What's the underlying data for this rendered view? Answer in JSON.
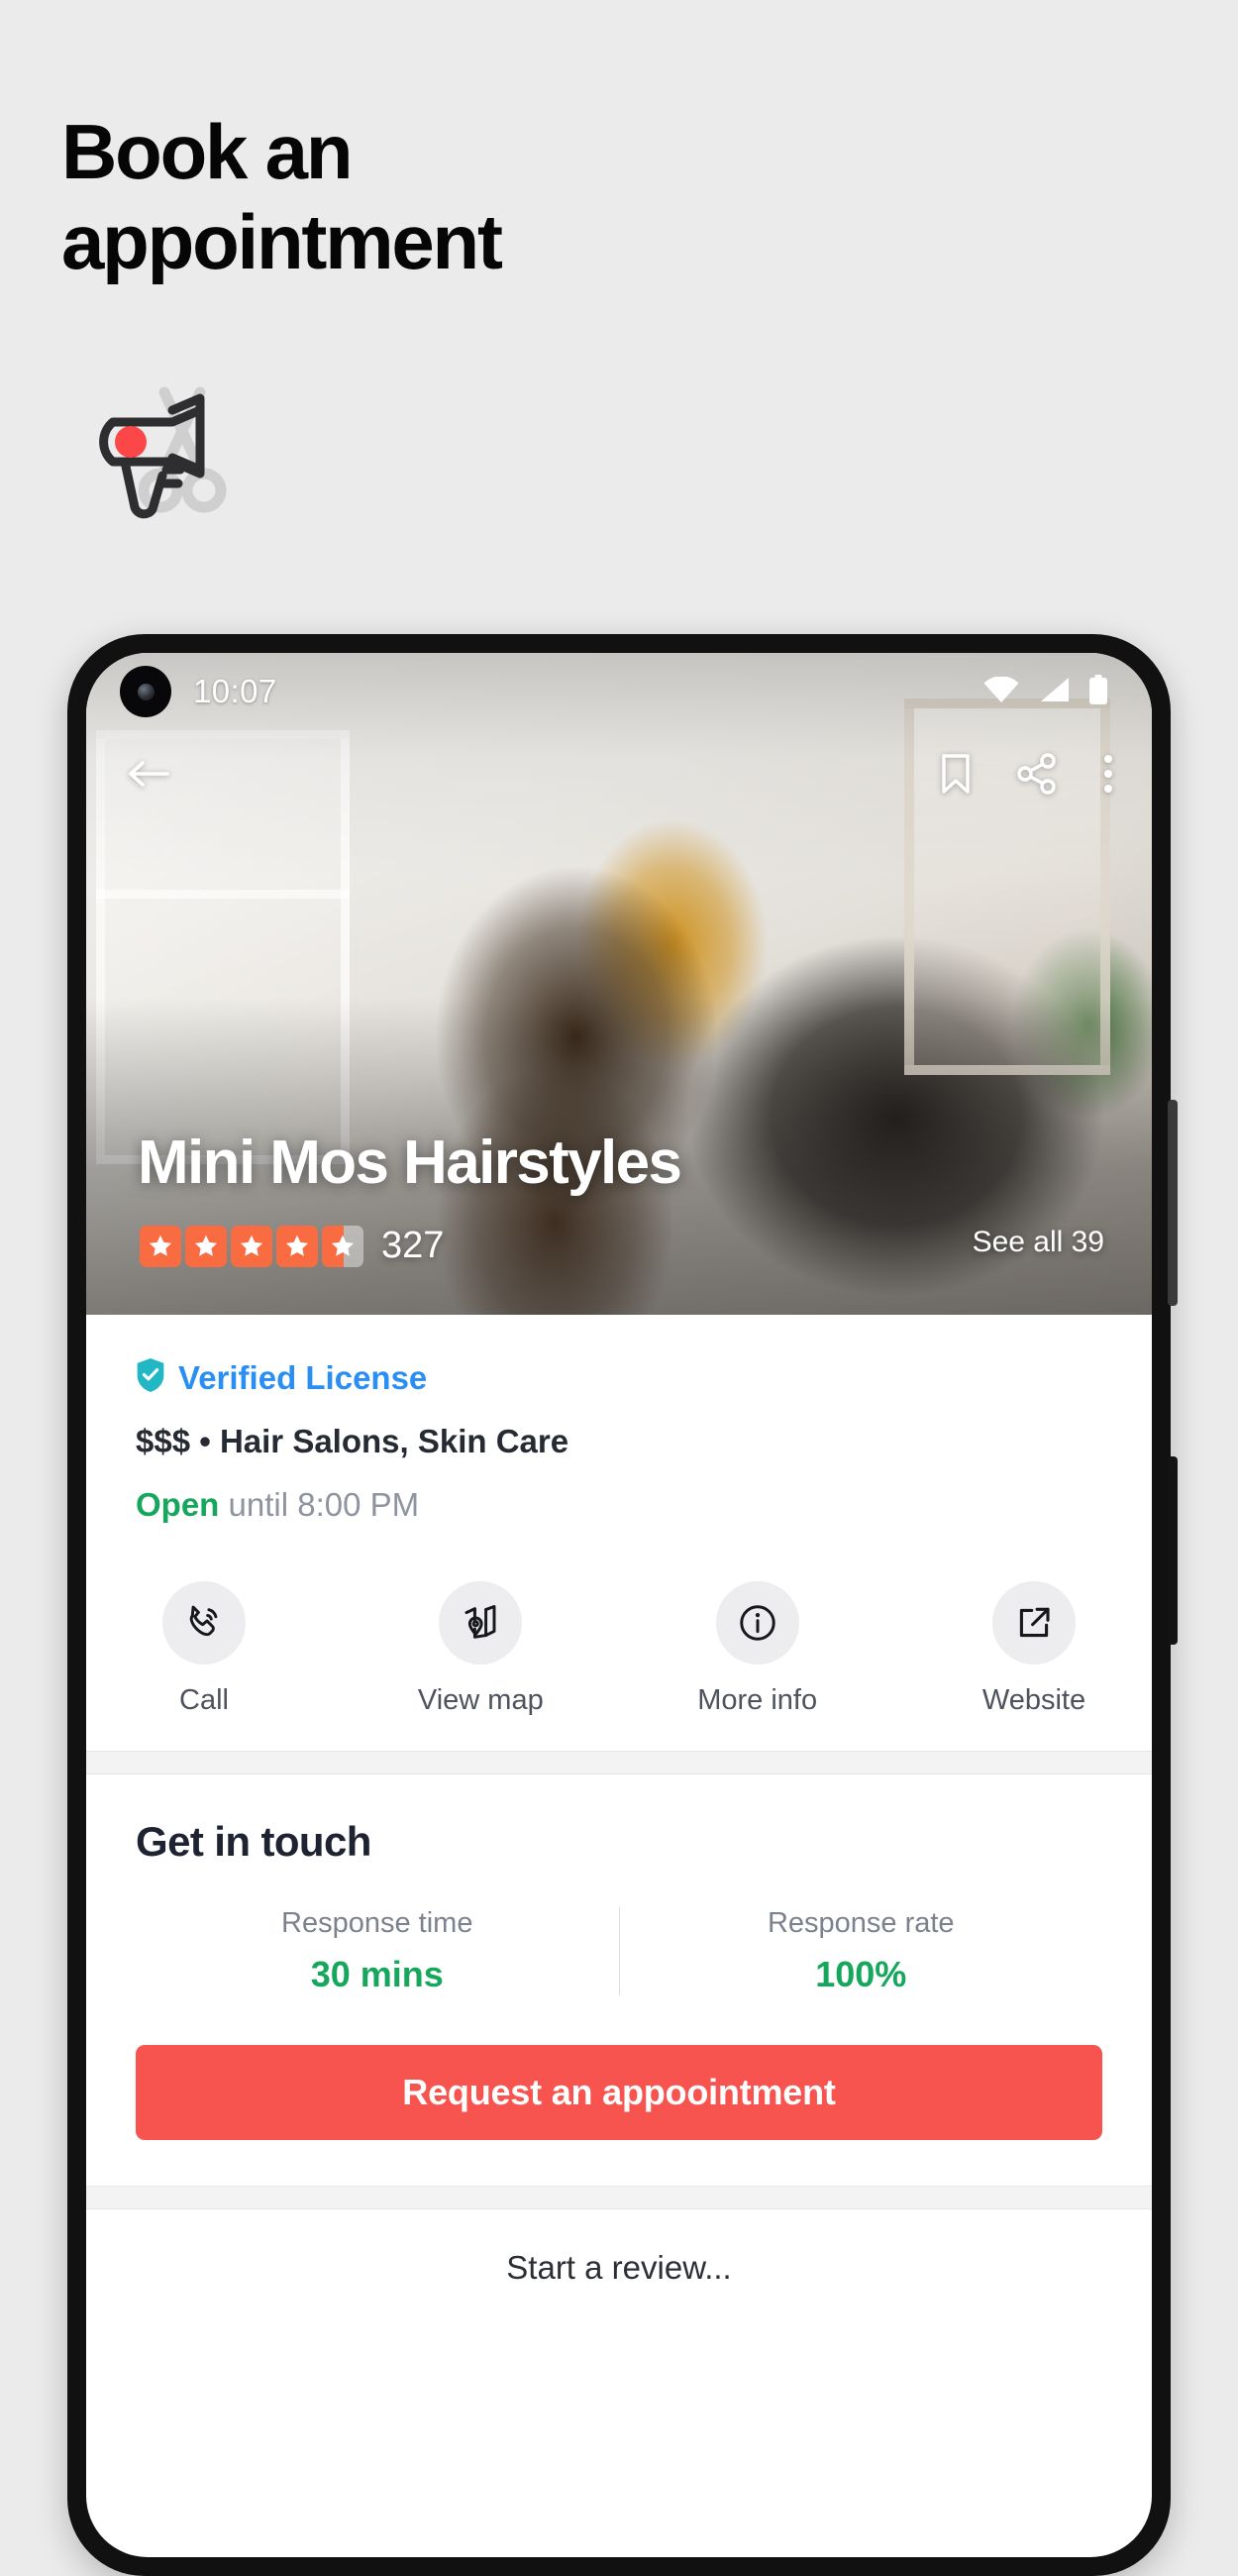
{
  "promo": {
    "headline_line1": "Book an",
    "headline_line2": "appointment",
    "icon": "hairdryer-scissors-icon",
    "accent_color": "#f8544f",
    "background_color": "#ebebeb"
  },
  "phone": {
    "status_bar": {
      "time": "10:07",
      "icons": [
        "wifi-icon",
        "cellular-signal-icon",
        "battery-icon"
      ]
    },
    "nav_bar": {
      "back": "back-arrow-icon",
      "bookmark": "bookmark-icon",
      "share": "share-icon",
      "overflow": "more-vertical-icon"
    },
    "hero": {
      "business_name": "Mini Mos Hairstyles",
      "rating_stars": 4.5,
      "star_count": 5,
      "review_count": "327",
      "see_all_label": "See all 39",
      "star_color": "#f96c42"
    },
    "info": {
      "verified_label": "Verified License",
      "verified_color": "#2b8ef4",
      "price_range": "$$$",
      "categories": "Hair Salons, Skin Care",
      "meta_line": "$$$ • Hair Salons, Skin Care",
      "status_open": "Open",
      "status_rest": "until 8:00 PM",
      "open_color": "#16a75c"
    },
    "actions": [
      {
        "label": "Call",
        "icon": "phone-call-icon"
      },
      {
        "label": "View map",
        "icon": "map-pin-icon"
      },
      {
        "label": "More info",
        "icon": "info-circle-icon"
      },
      {
        "label": "Website",
        "icon": "external-link-icon"
      }
    ],
    "get_in_touch": {
      "title": "Get in touch",
      "stats": [
        {
          "label": "Response time",
          "value": "30 mins"
        },
        {
          "label": "Response rate",
          "value": "100%"
        }
      ],
      "cta_label": "Request an appoointment",
      "cta_color": "#f8544f"
    },
    "review": {
      "placeholder": "Start a review..."
    }
  }
}
